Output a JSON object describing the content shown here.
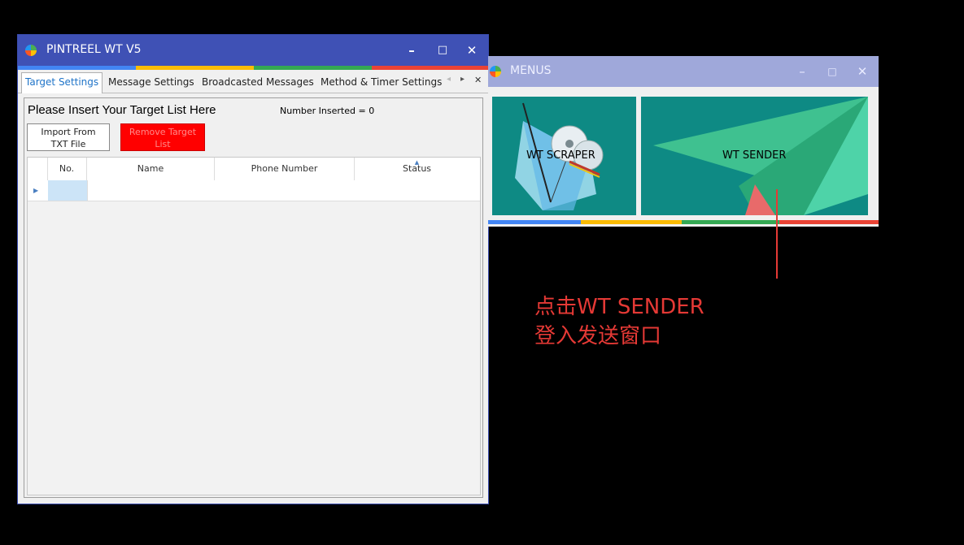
{
  "main_window": {
    "title": "PINTREEL WT V5",
    "controls": {
      "minimize": "–",
      "maximize": "□",
      "close": "✕"
    },
    "tabs": [
      {
        "label": "Target Settings",
        "active": true
      },
      {
        "label": "Message Settings",
        "active": false
      },
      {
        "label": "Broadcasted Messages",
        "active": false
      },
      {
        "label": "Method & Timer Settings",
        "active": false
      }
    ],
    "tab_nav": {
      "prev": "◂",
      "next": "▸",
      "close": "✕"
    },
    "heading": "Please Insert Your Target List Here",
    "count_text": "Number Inserted = 0",
    "buttons": {
      "import_line1": "Import From",
      "import_line2": "TXT File",
      "remove_line1": "Remove Target",
      "remove_line2": "List"
    },
    "grid": {
      "columns": [
        "No.",
        "Name",
        "Phone Number",
        "Status"
      ],
      "row_indicator": "▶",
      "sort_indicator": "▲"
    }
  },
  "menus_window": {
    "title": "MENUS",
    "controls": {
      "minimize": "–",
      "maximize": "□",
      "close": "✕"
    },
    "tiles": [
      {
        "label": "WT SCRAPER"
      },
      {
        "label": "WT SENDER"
      }
    ]
  },
  "annotation": {
    "line1": "点击WT SENDER",
    "line2": "登入发送窗口",
    "color": "#e53935"
  },
  "colors": {
    "titlebar_active": "#3f51b5",
    "titlebar_inactive": "#9fa8da",
    "tile_bg": "#0e8a84",
    "stripe": [
      "#4285f4",
      "#fbbc05",
      "#34a853",
      "#ea4335"
    ],
    "remove_button": "#ff0000"
  }
}
